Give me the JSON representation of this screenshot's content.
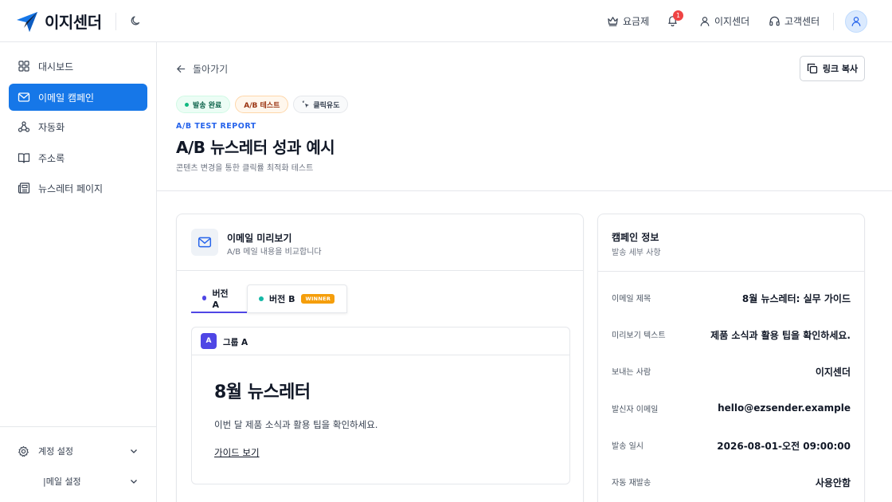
{
  "brand": {
    "name": "이지센더",
    "accent": "#1677e8"
  },
  "header": {
    "plan_label": "요금제",
    "notification_count": "1",
    "account_label": "이지센더",
    "support_label": "고객센터"
  },
  "sidebar": {
    "items": [
      {
        "label": "대시보드",
        "icon": "dashboard-icon"
      },
      {
        "label": "이메일 캠페인",
        "icon": "mail-icon",
        "active": true
      },
      {
        "label": "자동화",
        "icon": "webhook-icon"
      },
      {
        "label": "주소록",
        "icon": "book-icon"
      },
      {
        "label": "뉴스레터 페이지",
        "icon": "newspaper-icon"
      }
    ],
    "bottom": [
      {
        "label": "계정 설정",
        "icon": "gear-icon"
      },
      {
        "label": "|메일 설정"
      }
    ]
  },
  "page": {
    "back_label": "돌아가기",
    "copy_link_label": "링크 복사",
    "badges": [
      "발송 완료",
      "A/B 테스트",
      "클릭유도"
    ],
    "kicker": "A/B TEST REPORT",
    "title": "A/B 뉴스레터 성과 예시",
    "subtitle": "콘텐츠 변경을 통한 클릭률 최적화 테스트"
  },
  "preview": {
    "title": "이메일 미리보기",
    "subtitle": "A/B 메일 내용을 비교합니다",
    "tabs": [
      {
        "label": "버전 A",
        "color": "#4f46e5"
      },
      {
        "label": "버전 B",
        "color": "#14b8a6",
        "badge": "WINNER"
      }
    ],
    "group_badge": "A",
    "group_label": "그룹 A",
    "newsletter_title": "8월 뉴스레터",
    "newsletter_text": "이번 달 제품 소식과 활용 팁을 확인하세요.",
    "newsletter_link": "가이드 보기"
  },
  "info": {
    "title": "캠페인 정보",
    "subtitle": "발송 세부 사항",
    "rows": [
      {
        "key": "이메일 제목",
        "value": "8월 뉴스레터: 실무 가이드"
      },
      {
        "key": "미리보기 텍스트",
        "value": "제품 소식과 활용 팁을 확인하세요."
      },
      {
        "key": "보내는 사람",
        "value": "이지센더"
      },
      {
        "key": "발신자 이메일",
        "value": "hello@ezsender.example"
      },
      {
        "key": "발송 일시",
        "value": "2026-08-01-오전 09:00:00"
      },
      {
        "key": "자동 재발송",
        "value": "사용안함"
      }
    ]
  }
}
